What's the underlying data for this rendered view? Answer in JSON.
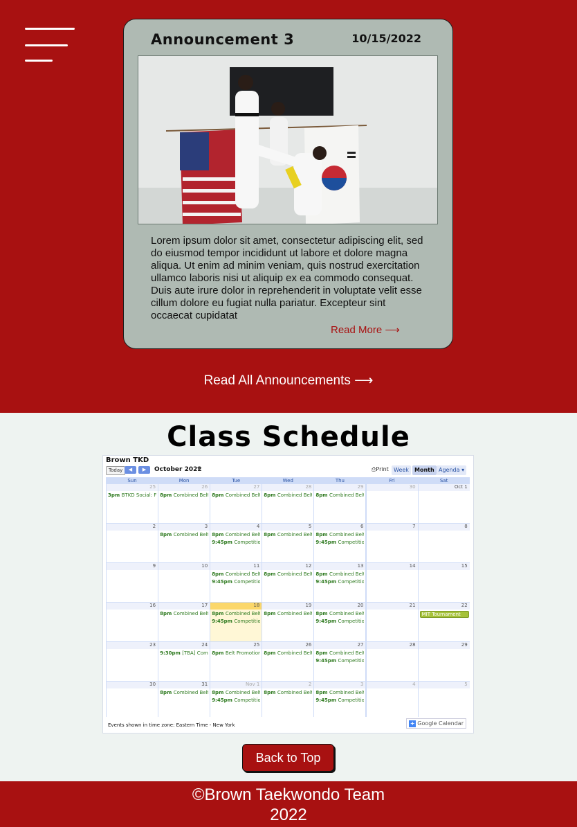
{
  "announcement": {
    "title": "Announcement 3",
    "date": "10/15/2022",
    "body": "Lorem ipsum dolor sit amet, consectetur adipiscing elit, sed do eiusmod tempor incididunt ut labore et dolore magna aliqua. Ut enim ad minim veniam, quis nostrud exercitation ullamco laboris nisi ut aliquip ex ea commodo consequat. Duis aute irure dolor in reprehenderit in voluptate velit esse cillum dolore eu fugiat nulla pariatur. Excepteur sint occaecat cupidatat",
    "read_more": "Read More ⟶",
    "read_all": "Read All Announcements ⟶"
  },
  "schedule": {
    "title": "Class Schedule",
    "calendar": {
      "name": "Brown TKD",
      "today_label": "Today",
      "month_label": "October 2022",
      "print_label": "Print",
      "views": [
        "Week",
        "Month",
        "Agenda"
      ],
      "days_of_week": [
        "Sun",
        "Mon",
        "Tue",
        "Wed",
        "Thu",
        "Fri",
        "Sat"
      ],
      "weeks": [
        [
          {
            "d": "25",
            "out": true,
            "ev": [
              [
                "3pm",
                "BTKD Social: Fi"
              ]
            ]
          },
          {
            "d": "26",
            "out": true,
            "ev": [
              [
                "8pm",
                "Combined Belt"
              ]
            ]
          },
          {
            "d": "27",
            "out": true,
            "ev": [
              [
                "8pm",
                "Combined Belt"
              ]
            ]
          },
          {
            "d": "28",
            "out": true,
            "ev": [
              [
                "8pm",
                "Combined Belt"
              ]
            ]
          },
          {
            "d": "29",
            "out": true,
            "ev": [
              [
                "8pm",
                "Combined Belt"
              ]
            ]
          },
          {
            "d": "30",
            "out": true,
            "ev": []
          },
          {
            "d": "Oct 1",
            "ev": []
          }
        ],
        [
          {
            "d": "2",
            "ev": []
          },
          {
            "d": "3",
            "ev": [
              [
                "8pm",
                "Combined Belt"
              ]
            ]
          },
          {
            "d": "4",
            "ev": [
              [
                "8pm",
                "Combined Belt"
              ],
              [
                "9:45pm",
                "Competition"
              ]
            ]
          },
          {
            "d": "5",
            "ev": [
              [
                "8pm",
                "Combined Belt"
              ]
            ]
          },
          {
            "d": "6",
            "ev": [
              [
                "8pm",
                "Combined Belt"
              ],
              [
                "9:45pm",
                "Competition"
              ]
            ]
          },
          {
            "d": "7",
            "ev": []
          },
          {
            "d": "8",
            "ev": []
          }
        ],
        [
          {
            "d": "9",
            "ev": []
          },
          {
            "d": "10",
            "ev": []
          },
          {
            "d": "11",
            "ev": [
              [
                "8pm",
                "Combined Belt"
              ],
              [
                "9:45pm",
                "Competition"
              ]
            ]
          },
          {
            "d": "12",
            "ev": [
              [
                "8pm",
                "Combined Belt"
              ]
            ]
          },
          {
            "d": "13",
            "ev": [
              [
                "8pm",
                "Combined Belt"
              ],
              [
                "9:45pm",
                "Competition"
              ]
            ]
          },
          {
            "d": "14",
            "ev": []
          },
          {
            "d": "15",
            "ev": []
          }
        ],
        [
          {
            "d": "16",
            "ev": []
          },
          {
            "d": "17",
            "ev": [
              [
                "8pm",
                "Combined Belt"
              ]
            ]
          },
          {
            "d": "18",
            "today": true,
            "ev": [
              [
                "8pm",
                "Combined Belt"
              ],
              [
                "9:45pm",
                "Competition"
              ]
            ]
          },
          {
            "d": "19",
            "ev": [
              [
                "8pm",
                "Combined Belt"
              ]
            ]
          },
          {
            "d": "20",
            "ev": [
              [
                "8pm",
                "Combined Belt"
              ],
              [
                "9:45pm",
                "Competition"
              ]
            ]
          },
          {
            "d": "21",
            "ev": []
          },
          {
            "d": "22",
            "ev": [
              [
                "",
                "MIT Tournament",
                "block"
              ]
            ]
          }
        ],
        [
          {
            "d": "23",
            "ev": []
          },
          {
            "d": "24",
            "ev": [
              [
                "9:30pm",
                "[TBA] Combi"
              ]
            ]
          },
          {
            "d": "25",
            "ev": [
              [
                "8pm",
                "Belt Promotion"
              ]
            ]
          },
          {
            "d": "26",
            "ev": [
              [
                "8pm",
                "Combined Belt"
              ]
            ]
          },
          {
            "d": "27",
            "ev": [
              [
                "8pm",
                "Combined Belt"
              ],
              [
                "9:45pm",
                "Competition"
              ]
            ]
          },
          {
            "d": "28",
            "ev": []
          },
          {
            "d": "29",
            "ev": []
          }
        ],
        [
          {
            "d": "30",
            "ev": []
          },
          {
            "d": "31",
            "ev": [
              [
                "8pm",
                "Combined Belt"
              ]
            ]
          },
          {
            "d": "Nov 1",
            "out": true,
            "ev": [
              [
                "8pm",
                "Combined Belt"
              ],
              [
                "9:45pm",
                "Competition"
              ]
            ]
          },
          {
            "d": "2",
            "out": true,
            "ev": [
              [
                "8pm",
                "Combined Belt"
              ]
            ]
          },
          {
            "d": "3",
            "out": true,
            "ev": [
              [
                "8pm",
                "Combined Belt"
              ],
              [
                "9:45pm",
                "Competition"
              ]
            ]
          },
          {
            "d": "4",
            "out": true,
            "ev": []
          },
          {
            "d": "5",
            "out": true,
            "ev": []
          }
        ]
      ],
      "timezone_note": "Events shown in time zone: Eastern Time - New York",
      "google_calendar_label": "Google Calendar"
    }
  },
  "back_to_top": "Back to Top",
  "footer": {
    "line1": "©Brown Taekwondo Team",
    "line2": "2022"
  }
}
